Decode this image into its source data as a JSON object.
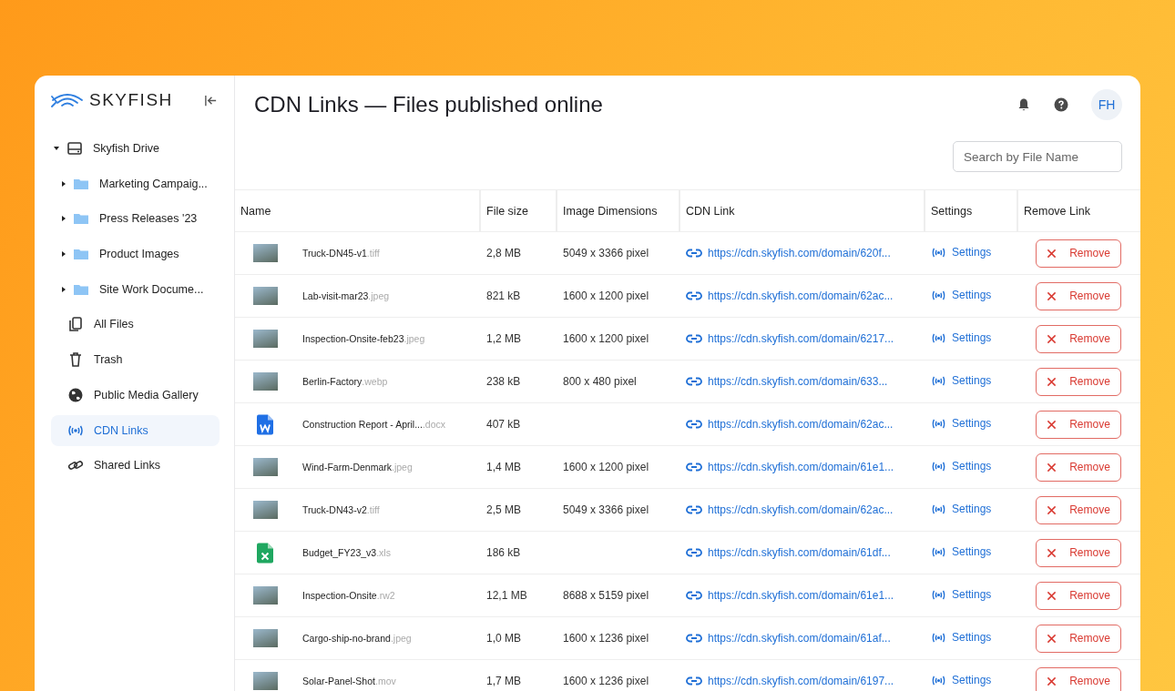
{
  "brand": {
    "name": "SKYFISH"
  },
  "sidebar": {
    "tree": [
      {
        "label": "Skyfish Drive",
        "kind": "drive",
        "expanded": true,
        "selected": false,
        "children": [
          {
            "label": "Marketing Campaig...",
            "kind": "folder",
            "expanded": false,
            "selected": false
          },
          {
            "label": "Press Releases '23",
            "kind": "folder",
            "expanded": false,
            "selected": false
          },
          {
            "label": "Product Images",
            "kind": "folder",
            "expanded": false,
            "selected": false
          },
          {
            "label": "Site Work Docume...",
            "kind": "folder",
            "expanded": false,
            "selected": false
          }
        ]
      }
    ],
    "items": [
      {
        "label": "All Files",
        "kind": "files",
        "selected": false
      },
      {
        "label": "Trash",
        "kind": "trash",
        "selected": false
      },
      {
        "label": "Public Media Gallery",
        "kind": "globe",
        "selected": false
      },
      {
        "label": "CDN Links",
        "kind": "signal",
        "selected": true
      },
      {
        "label": "Shared Links",
        "kind": "link",
        "selected": false
      }
    ]
  },
  "header": {
    "title": "CDN Links — Files published online",
    "avatar": "FH"
  },
  "search": {
    "placeholder": "Search by File Name"
  },
  "table": {
    "columns": [
      "Name",
      "File size",
      "Image Dimensions",
      "CDN Link",
      "Settings",
      "Remove Link"
    ],
    "rows": [
      {
        "kind": "photo",
        "name": "Truck-DN45-v1",
        "ext": ".tiff",
        "size": "2,8 MB",
        "dims": "5049 x 3366 pixel",
        "link": "https://cdn.skyfish.com/domain/620f...",
        "settings": "Settings",
        "remove": "Remove"
      },
      {
        "kind": "photo",
        "name": "Lab-visit-mar23",
        "ext": ".jpeg",
        "size": "821 kB",
        "dims": "1600 x 1200 pixel",
        "link": "https://cdn.skyfish.com/domain/62ac...",
        "settings": "Settings",
        "remove": "Remove"
      },
      {
        "kind": "photo",
        "name": "Inspection-Onsite-feb23",
        "ext": ".jpeg",
        "size": "1,2 MB",
        "dims": "1600 x 1200 pixel",
        "link": "https://cdn.skyfish.com/domain/6217...",
        "settings": "Settings",
        "remove": "Remove"
      },
      {
        "kind": "photo",
        "name": "Berlin-Factory",
        "ext": ".webp",
        "size": "238 kB",
        "dims": "800 x 480 pixel",
        "link": "https://cdn.skyfish.com/domain/633...",
        "settings": "Settings",
        "remove": "Remove"
      },
      {
        "kind": "word",
        "name": "Construction Report - April...",
        "ext": ".docx",
        "size": "407 kB",
        "link": "https://cdn.skyfish.com/domain/62ac...",
        "settings": "Settings",
        "remove": "Remove"
      },
      {
        "kind": "photo",
        "name": "Wind-Farm-Denmark",
        "ext": ".jpeg",
        "size": "1,4 MB",
        "dims": "1600 x 1200 pixel",
        "link": "https://cdn.skyfish.com/domain/61e1...",
        "settings": "Settings",
        "remove": "Remove"
      },
      {
        "kind": "photo",
        "name": "Truck-DN43-v2",
        "ext": ".tiff",
        "size": "2,5 MB",
        "dims": "5049 x 3366 pixel",
        "link": "https://cdn.skyfish.com/domain/62ac...",
        "settings": "Settings",
        "remove": "Remove"
      },
      {
        "kind": "excel",
        "name": "Budget_FY23_v3",
        "ext": ".xls",
        "size": "186 kB",
        "link": "https://cdn.skyfish.com/domain/61df...",
        "settings": "Settings",
        "remove": "Remove"
      },
      {
        "kind": "photo",
        "name": "Inspection-Onsite",
        "ext": ".rw2",
        "size": "12,1 MB",
        "dims": "8688 x 5159 pixel",
        "link": "https://cdn.skyfish.com/domain/61e1...",
        "settings": "Settings",
        "remove": "Remove"
      },
      {
        "kind": "photo",
        "name": "Cargo-ship-no-brand",
        "ext": ".jpeg",
        "size": "1,0 MB",
        "dims": "1600 x 1236 pixel",
        "link": "https://cdn.skyfish.com/domain/61af...",
        "settings": "Settings",
        "remove": "Remove"
      },
      {
        "kind": "photo",
        "name": "Solar-Panel-Shot",
        "ext": ".mov",
        "size": "1,7 MB",
        "dims": "1600 x 1236 pixel",
        "link": "https://cdn.skyfish.com/domain/6197...",
        "settings": "Settings",
        "remove": "Remove"
      }
    ]
  }
}
